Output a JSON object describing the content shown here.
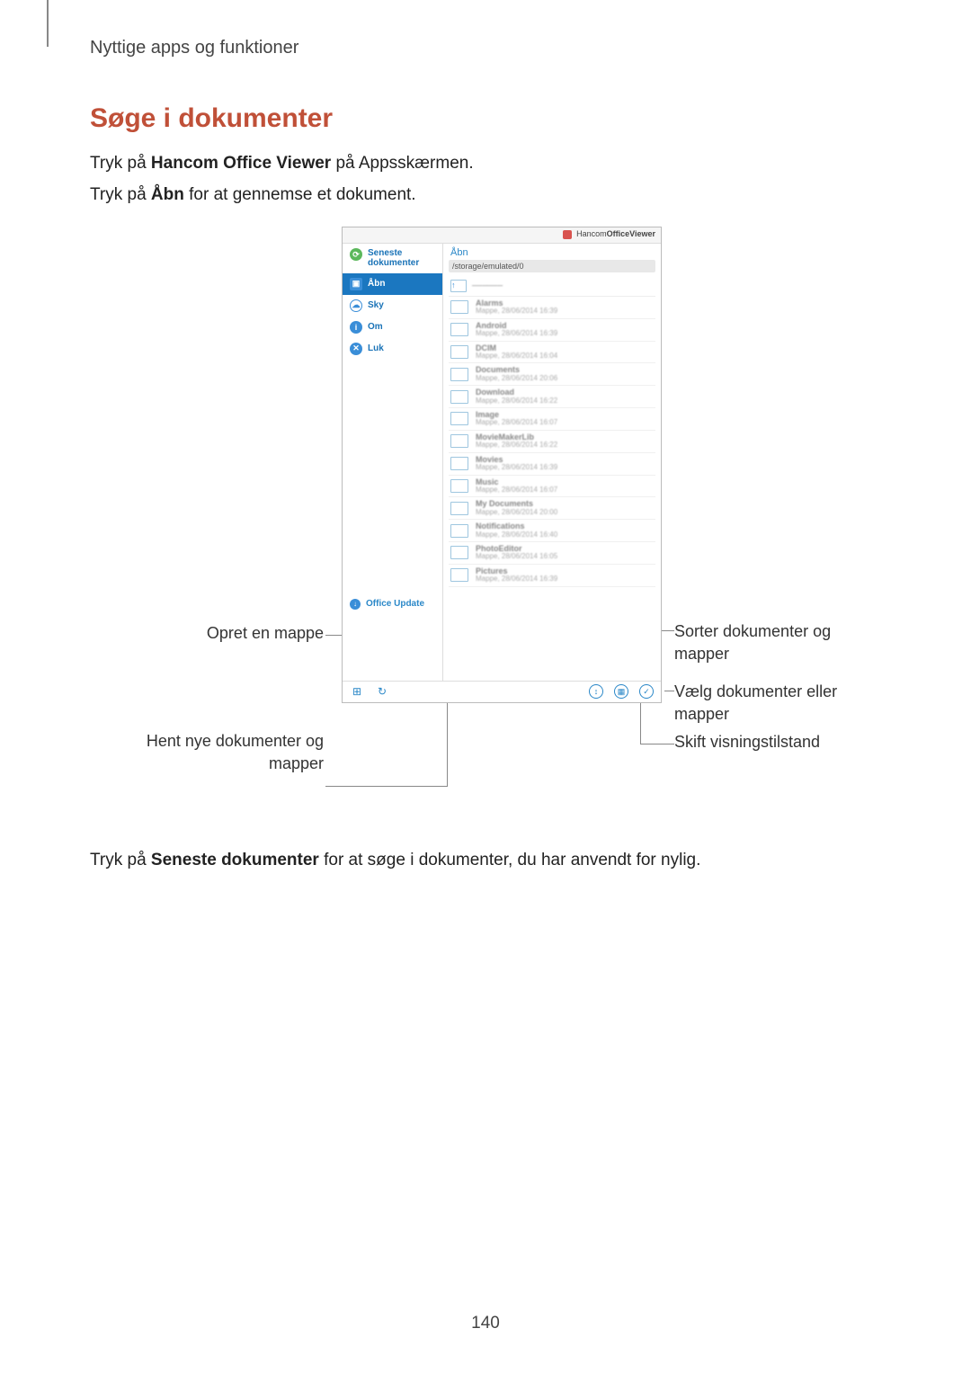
{
  "header_label": "Nyttige apps og funktioner",
  "section_title": "Søge i dokumenter",
  "body": {
    "p1_prefix": "Tryk på ",
    "p1_bold": "Hancom Office Viewer",
    "p1_suffix": " på Appsskærmen.",
    "p2_prefix": "Tryk på ",
    "p2_bold": "Åbn",
    "p2_suffix": " for at gennemse et dokument.",
    "p3_prefix": "Tryk på ",
    "p3_bold": "Seneste dokumenter",
    "p3_suffix": " for at søge i dokumenter, du har anvendt for nylig."
  },
  "callouts": {
    "left1": "Opret en mappe",
    "left2": "Hent nye dokumenter og mapper",
    "right3": "Sorter dokumenter og mapper",
    "right4": "Vælg dokumenter eller mapper",
    "right5": "Skift visningstilstand"
  },
  "phone": {
    "brand_name": "Hancom",
    "brand_suffix": "OfficeViewer",
    "sidebar": {
      "recent": "Seneste dokumenter",
      "open": "Åbn",
      "sky": "Sky",
      "about": "Om",
      "close": "Luk",
      "update": "Office Update"
    },
    "panel_title": "Åbn",
    "path": "/storage/emulated/0",
    "folders": [
      {
        "name": "Alarms",
        "date": "Mappe, 28/06/2014 16:39"
      },
      {
        "name": "Android",
        "date": "Mappe, 28/06/2014 16:39"
      },
      {
        "name": "DCIM",
        "date": "Mappe, 28/06/2014 16:04"
      },
      {
        "name": "Documents",
        "date": "Mappe, 28/06/2014 20:06"
      },
      {
        "name": "Download",
        "date": "Mappe, 28/06/2014 16:22"
      },
      {
        "name": "Image",
        "date": "Mappe, 28/06/2014 16:07"
      },
      {
        "name": "MovieMakerLib",
        "date": "Mappe, 28/06/2014 16:22"
      },
      {
        "name": "Movies",
        "date": "Mappe, 28/06/2014 16:39"
      },
      {
        "name": "Music",
        "date": "Mappe, 28/06/2014 16:07"
      },
      {
        "name": "My Documents",
        "date": "Mappe, 28/06/2014 20:00"
      },
      {
        "name": "Notifications",
        "date": "Mappe, 28/06/2014 16:40"
      },
      {
        "name": "PhotoEditor",
        "date": "Mappe, 28/06/2014 16:05"
      },
      {
        "name": "Pictures",
        "date": "Mappe, 28/06/2014 16:39"
      }
    ]
  },
  "page_number": "140"
}
